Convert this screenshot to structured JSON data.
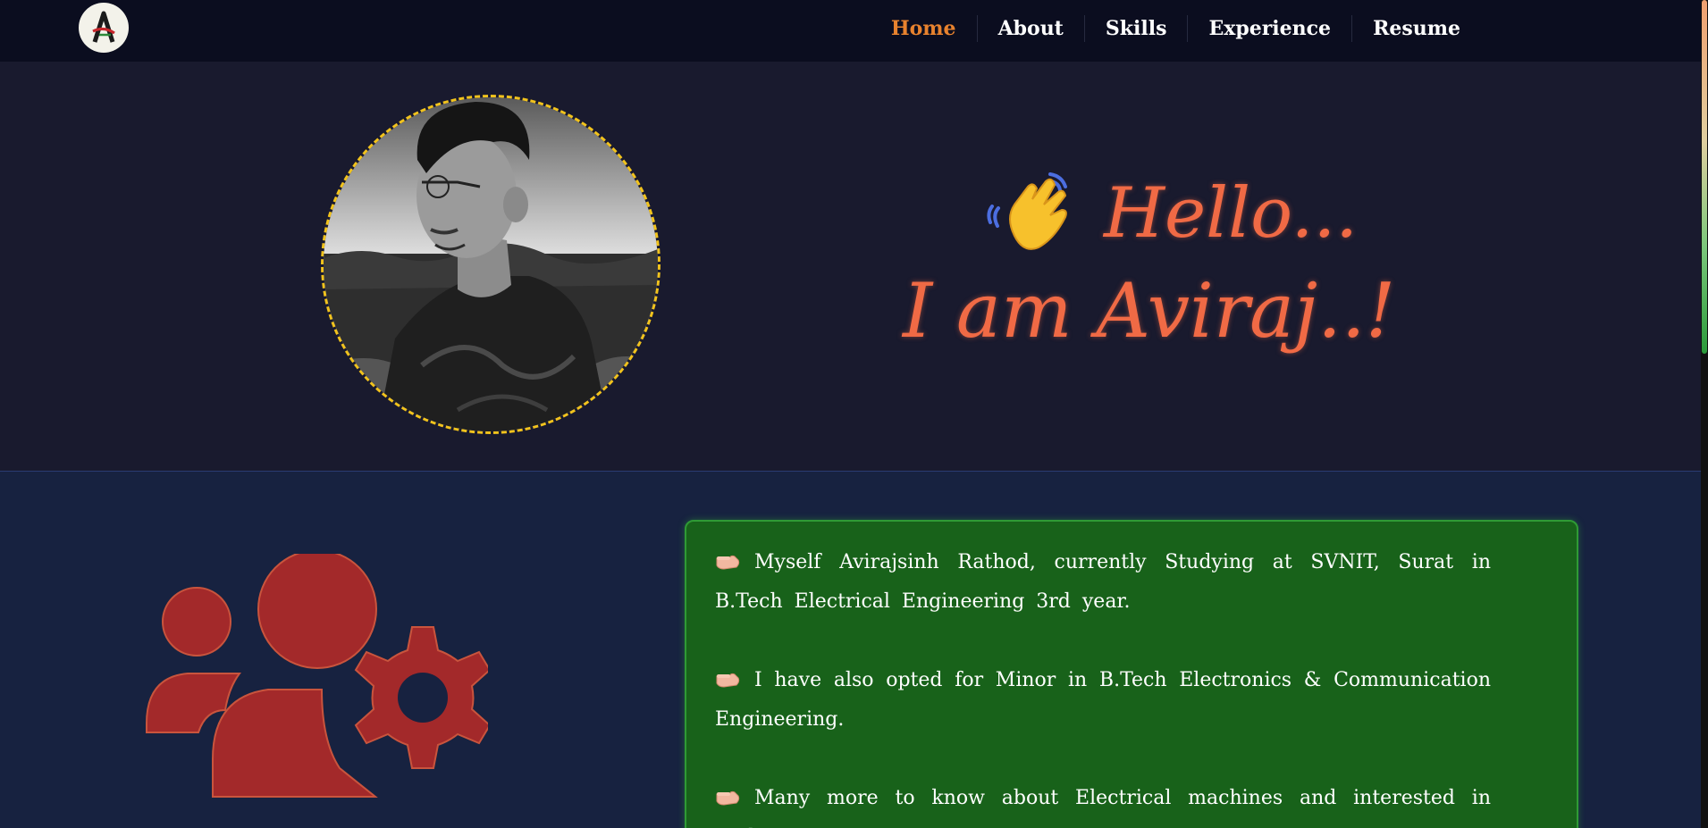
{
  "navbar": {
    "logo_letter": "A",
    "items": [
      {
        "label": "Home",
        "active": true
      },
      {
        "label": "About",
        "active": false
      },
      {
        "label": "Skills",
        "active": false
      },
      {
        "label": "Experience",
        "active": false
      },
      {
        "label": "Resume",
        "active": false
      }
    ],
    "active_color": "#e8822e"
  },
  "hero": {
    "greeting_line1": "Hello...",
    "greeting_line2": "I am Aviraj..!",
    "greeting_color": "#f06a45",
    "photo_border_color": "#f2c31c"
  },
  "about": {
    "icon": "team-gear-icon",
    "icon_color": "#a3292a",
    "bullet_icon": "pointing-hand-icon",
    "paragraphs": [
      "Myself Avirajsinh Rathod, currently Studying at SVNIT, Surat in B.Tech Electrical Engineering 3rd year.",
      "I have also opted for Minor in B.Tech Electronics & Communication Engineering.",
      "Many more to know about Electrical machines and interested in Coding..!"
    ],
    "card_color": "#18621a"
  }
}
